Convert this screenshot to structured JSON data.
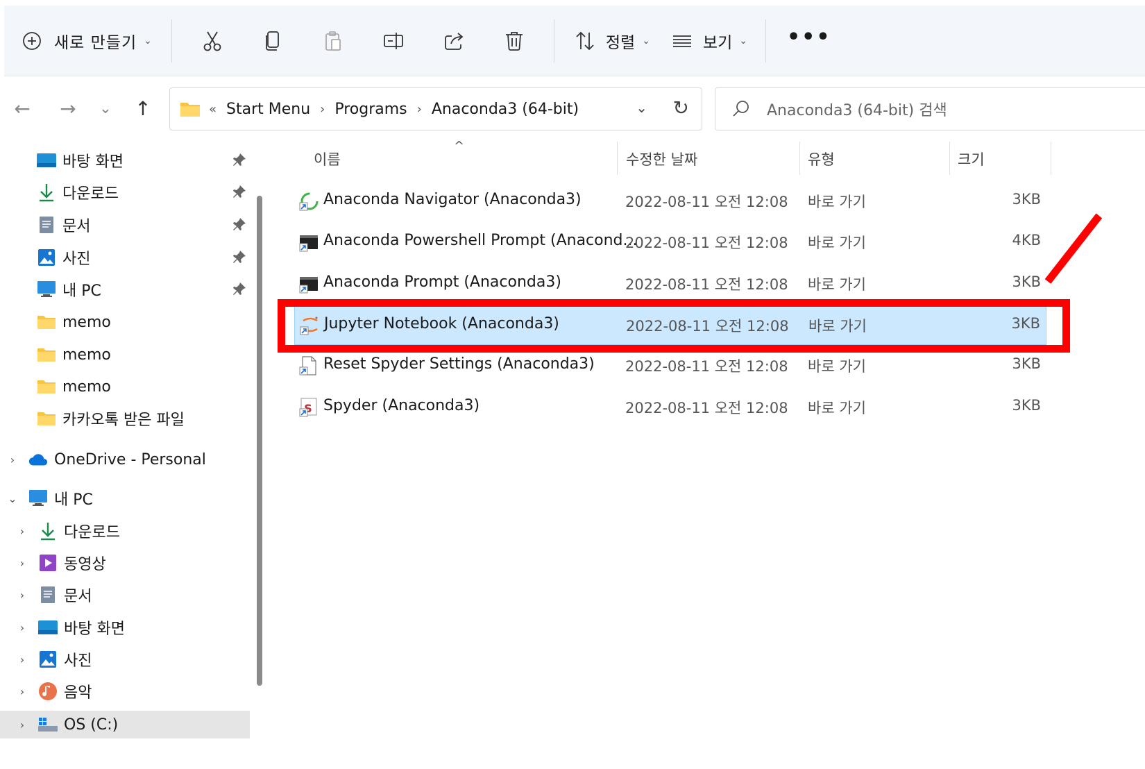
{
  "toolbar": {
    "new_label": "새로 만들기",
    "sort_label": "정렬",
    "view_label": "보기",
    "more": "•••"
  },
  "nav": {
    "back": "←",
    "forward": "→",
    "recent": "⌄",
    "up": "↑"
  },
  "address": {
    "overflow": "«",
    "crumbs": [
      "Start Menu",
      "Programs",
      "Anaconda3 (64-bit)"
    ],
    "sep": "›"
  },
  "search": {
    "placeholder": "Anaconda3 (64-bit) 검색"
  },
  "sidebar": {
    "quick": [
      {
        "label": "바탕 화면",
        "icon": "desktop-icon",
        "pinned": true
      },
      {
        "label": "다운로드",
        "icon": "download-icon",
        "pinned": true
      },
      {
        "label": "문서",
        "icon": "document-icon",
        "pinned": true
      },
      {
        "label": "사진",
        "icon": "pictures-icon",
        "pinned": true
      },
      {
        "label": "내 PC",
        "icon": "pc-icon",
        "pinned": true
      },
      {
        "label": "memo",
        "icon": "folder-icon"
      },
      {
        "label": "memo",
        "icon": "folder-icon"
      },
      {
        "label": "memo",
        "icon": "folder-icon"
      },
      {
        "label": "카카오톡 받은 파일",
        "icon": "folder-icon"
      }
    ],
    "onedrive": "OneDrive - Personal",
    "thispc": "내 PC",
    "pc_children": [
      {
        "label": "다운로드",
        "icon": "download-icon"
      },
      {
        "label": "동영상",
        "icon": "video-icon"
      },
      {
        "label": "문서",
        "icon": "document-icon"
      },
      {
        "label": "바탕 화면",
        "icon": "desktop-icon"
      },
      {
        "label": "사진",
        "icon": "pictures-icon"
      },
      {
        "label": "음악",
        "icon": "music-icon"
      },
      {
        "label": "OS (C:)",
        "icon": "drive-icon"
      }
    ]
  },
  "columns": {
    "name": "이름",
    "date": "수정한 날짜",
    "type": "유형",
    "size": "크기",
    "sort_caret": "^"
  },
  "files": [
    {
      "name": "Anaconda Navigator (Anaconda3)",
      "date": "2022-08-11 오전 12:08",
      "type": "바로 가기",
      "size": "3KB",
      "icon": "anaconda-navigator-icon"
    },
    {
      "name": "Anaconda Powershell Prompt (Anacond...",
      "date": "2022-08-11 오전 12:08",
      "type": "바로 가기",
      "size": "4KB",
      "icon": "terminal-icon"
    },
    {
      "name": "Anaconda Prompt (Anaconda3)",
      "date": "2022-08-11 오전 12:08",
      "type": "바로 가기",
      "size": "3KB",
      "icon": "terminal-icon"
    },
    {
      "name": "Jupyter Notebook (Anaconda3)",
      "date": "2022-08-11 오전 12:08",
      "type": "바로 가기",
      "size": "3KB",
      "icon": "jupyter-icon",
      "selected": true
    },
    {
      "name": "Reset Spyder Settings (Anaconda3)",
      "date": "2022-08-11 오전 12:08",
      "type": "바로 가기",
      "size": "3KB",
      "icon": "file-shortcut-icon"
    },
    {
      "name": "Spyder (Anaconda3)",
      "date": "2022-08-11 오전 12:08",
      "type": "바로 가기",
      "size": "3KB",
      "icon": "spyder-icon"
    }
  ],
  "colors": {
    "selection": "#cce8ff",
    "highlight": "#ff0000",
    "toolbar_bg": "#f3f6fb"
  }
}
